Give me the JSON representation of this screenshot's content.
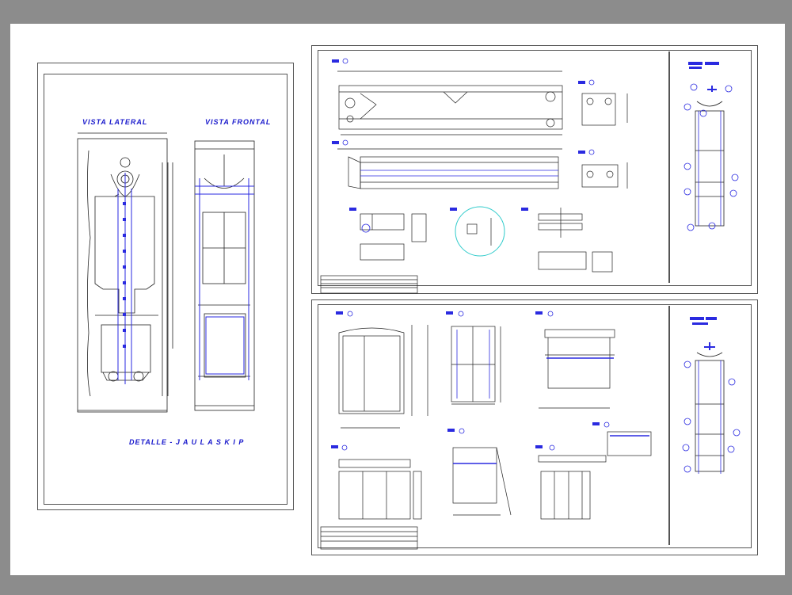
{
  "left_sheet": {
    "view_lateral_label": "VISTA LATERAL",
    "view_frontal_label": "VISTA FRONTAL",
    "detail_title": "DETALLE - J A U L A   S K I P"
  },
  "colors": {
    "background": "#8c8c8c",
    "sheet": "#ffffff",
    "line": "#1a1a1a",
    "accent_blue": "#1a1acc",
    "circle_cyan": "#33cccc"
  },
  "icons": [
    "callout-balloon-icon",
    "section-marker-icon",
    "detail-circle-icon"
  ]
}
